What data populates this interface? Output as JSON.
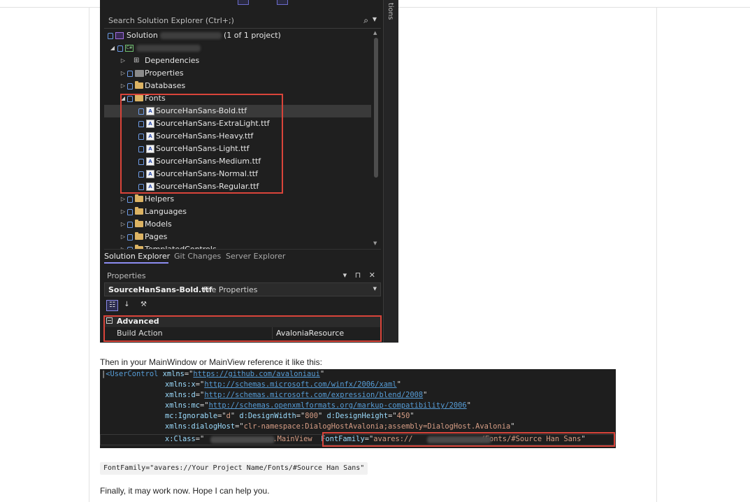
{
  "vs_panel": {
    "side_tab_label": "tions",
    "search_placeholder": "Search Solution Explorer (Ctrl+;)",
    "search_icon": "search-icon",
    "tree": {
      "solution_label": "Solution",
      "solution_suffix": "(1 of 1 project)",
      "items": [
        {
          "label": "Dependencies"
        },
        {
          "label": "Properties"
        },
        {
          "label": "Databases"
        },
        {
          "label": "Fonts"
        },
        {
          "label": "SourceHanSans-Bold.ttf"
        },
        {
          "label": "SourceHanSans-ExtraLight.ttf"
        },
        {
          "label": "SourceHanSans-Heavy.ttf"
        },
        {
          "label": "SourceHanSans-Light.ttf"
        },
        {
          "label": "SourceHanSans-Medium.ttf"
        },
        {
          "label": "SourceHanSans-Normal.ttf"
        },
        {
          "label": "SourceHanSans-Regular.ttf"
        },
        {
          "label": "Helpers"
        },
        {
          "label": "Languages"
        },
        {
          "label": "Models"
        },
        {
          "label": "Pages"
        },
        {
          "label": "TemplatedControls"
        }
      ]
    },
    "tabs": [
      "Solution Explorer",
      "Git Changes",
      "Server Explorer"
    ],
    "properties": {
      "title": "Properties",
      "controls": "▾ ⊓ ✕",
      "object_name": "SourceHanSans-Bold.ttf",
      "object_kind": "File Properties",
      "category": "Advanced",
      "rows": [
        {
          "key": "Build Action",
          "value": "AvaloniaResource"
        }
      ]
    }
  },
  "text": {
    "intro": "Then in your MainWindow or MainView reference it like this:",
    "inline_code": "FontFamily=\"avares://Your Project Name/Fonts/#Source Han Sans\"",
    "closing": "Finally, it may work now. Hope I can help you."
  },
  "code": {
    "l1_tag": "<UserControl",
    "l1_attr": " xmlns",
    "l1_eq": "=\"",
    "l1_url": "https://github.com/avaloniaui",
    "l1_end": "\"",
    "l2_attr": "xmlns:x",
    "l2_url": "http://schemas.microsoft.com/winfx/2006/xaml",
    "l3_attr": "xmlns:d",
    "l3_url": "http://schemas.microsoft.com/expression/blend/2008",
    "l4_attr": "xmlns:mc",
    "l4_url": "http://schemas.openxmlformats.org/markup-compatibility/2006",
    "l5_attr1": "mc:Ignorable",
    "l5_val1": "d",
    "l5_attr2": "d:DesignWidth",
    "l5_val2": "800",
    "l5_attr3": "d:DesignHeight",
    "l5_val3": "450",
    "l6_attr": "xmlns:dialogHost",
    "l6_val": "clr-namespace:DialogHostAvalonia;assembly=DialogHost.Avalonia",
    "l7_attr": "x:Class",
    "l7_val_tail": ".MainView",
    "l7_attr2": "FontFamily",
    "l7_val2_head": "avares://",
    "l7_val2_tail": "/Fonts/#Source Han Sans"
  }
}
